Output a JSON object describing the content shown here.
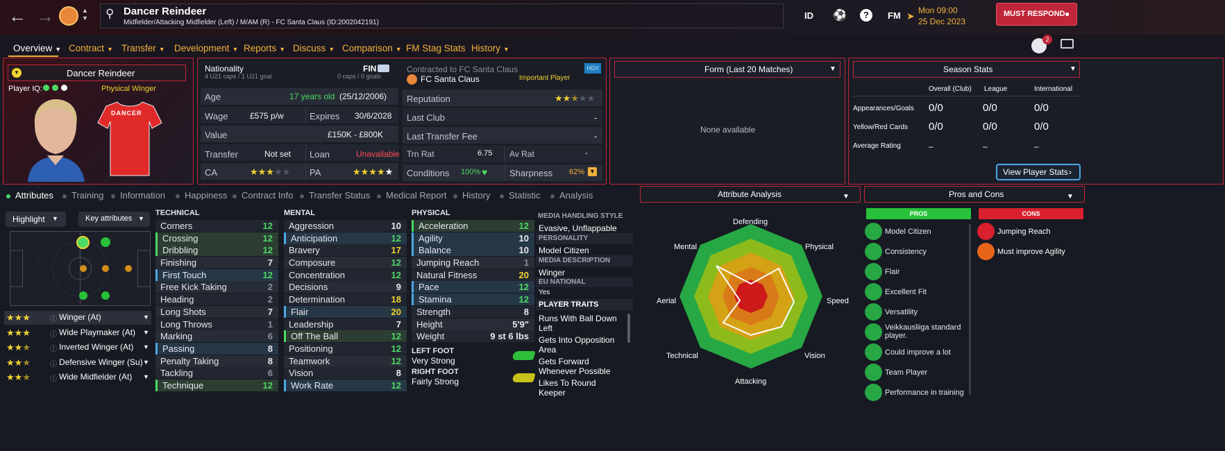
{
  "header": {
    "player_name": "Dancer Reindeer",
    "subtitle": "Midfielder/Attacking Midfielder (Left) / M/AM (R) - FC Santa Claus (ID:2002042191)",
    "id_label": "ID",
    "fm_label": "FM",
    "date_time": "Mon 09:00",
    "date": "25 Dec 2023",
    "must_respond": "MUST RESPOND"
  },
  "nav": {
    "overview": "Overview",
    "contract": "Contract",
    "transfer": "Transfer",
    "development": "Development",
    "reports": "Reports",
    "discuss": "Discuss",
    "comparison": "Comparison",
    "stag_stats": "FM Stag Stats",
    "history": "History",
    "notif_count": "2"
  },
  "profile": {
    "name": "Dancer Reindeer",
    "player_iq_label": "Player IQ:",
    "role": "Physical Winger",
    "shirt_name": "DANCER"
  },
  "info": {
    "nationality_label": "Nationality",
    "nation_code": "FIN",
    "u21_line": "4 U21 caps / 1 U21 goal",
    "caps_line": "0 caps / 0 goals",
    "age_label": "Age",
    "age_value": "17 years old",
    "dob": "(25/12/2006)",
    "wage_label": "Wage",
    "wage_value": "£575 p/w",
    "expires_label": "Expires",
    "expires_value": "30/6/2028",
    "value_label": "Value",
    "value_value": "£150K - £800K",
    "transfer_label": "Transfer",
    "transfer_value": "Not set",
    "loan_label": "Loan",
    "loan_value": "Unavailable",
    "ca_label": "CA",
    "pa_label": "PA",
    "ca_stars": 3,
    "pa_stars": 5
  },
  "club": {
    "contracted": "Contracted to FC Santa Claus",
    "club_name": "FC Santa Claus",
    "status": "Important Player",
    "badge": "HGV",
    "reputation_label": "Reputation",
    "reputation_stars": 2.5,
    "last_club_label": "Last Club",
    "last_club_value": "-",
    "last_fee_label": "Last Transfer Fee",
    "last_fee_value": "-",
    "trn_rat_label": "Trn Rat",
    "trn_rat_value": "6.75",
    "av_rat_label": "Av Rat",
    "av_rat_value": "-",
    "conditions_label": "Conditions",
    "conditions_value": "100%",
    "sharpness_label": "Sharpness",
    "sharpness_value": "62%"
  },
  "form": {
    "title": "Form (Last 20 Matches)",
    "empty": "None available"
  },
  "season": {
    "title": "Season Stats",
    "cols": [
      "Overall (Club)",
      "League",
      "International"
    ],
    "rows": [
      {
        "label": "Appearances/Goals",
        "values": [
          "0/0",
          "0/0",
          "0/0"
        ]
      },
      {
        "label": "Yellow/Red Cards",
        "values": [
          "0/0",
          "0/0",
          "0/0"
        ]
      },
      {
        "label": "Average Rating",
        "values": [
          "–",
          "–",
          "–"
        ]
      }
    ],
    "button": "View Player Stats"
  },
  "tabs": [
    "Attributes",
    "Training",
    "Information",
    "Happiness",
    "Contract Info",
    "Transfer Status",
    "Medical Report",
    "History",
    "Statistic",
    "Analysis"
  ],
  "controls": {
    "highlight": "Highlight",
    "key_attributes": "Key attributes"
  },
  "roles": [
    {
      "name": "Winger (At)",
      "stars": 3
    },
    {
      "name": "Wide Playmaker (At)",
      "stars": 3
    },
    {
      "name": "Inverted Winger (At)",
      "stars": 2.5
    },
    {
      "name": "Defensive Winger (Su)",
      "stars": 2.5
    },
    {
      "name": "Wide Midfielder (At)",
      "stars": 2.5
    }
  ],
  "technical": {
    "title": "TECHNICAL",
    "items": [
      {
        "name": "Corners",
        "value": "12"
      },
      {
        "name": "Crossing",
        "value": "12"
      },
      {
        "name": "Dribbling",
        "value": "12"
      },
      {
        "name": "Finishing",
        "value": "7"
      },
      {
        "name": "First Touch",
        "value": "12"
      },
      {
        "name": "Free Kick Taking",
        "value": "2"
      },
      {
        "name": "Heading",
        "value": "2"
      },
      {
        "name": "Long Shots",
        "value": "7"
      },
      {
        "name": "Long Throws",
        "value": "1"
      },
      {
        "name": "Marking",
        "value": "6"
      },
      {
        "name": "Passing",
        "value": "8"
      },
      {
        "name": "Penalty Taking",
        "value": "8"
      },
      {
        "name": "Tackling",
        "value": "6"
      },
      {
        "name": "Technique",
        "value": "12"
      }
    ]
  },
  "mental": {
    "title": "MENTAL",
    "items": [
      {
        "name": "Aggression",
        "value": "10"
      },
      {
        "name": "Anticipation",
        "value": "12"
      },
      {
        "name": "Bravery",
        "value": "17"
      },
      {
        "name": "Composure",
        "value": "12"
      },
      {
        "name": "Concentration",
        "value": "12"
      },
      {
        "name": "Decisions",
        "value": "9"
      },
      {
        "name": "Determination",
        "value": "18"
      },
      {
        "name": "Flair",
        "value": "20"
      },
      {
        "name": "Leadership",
        "value": "7"
      },
      {
        "name": "Off The Ball",
        "value": "12"
      },
      {
        "name": "Positioning",
        "value": "12"
      },
      {
        "name": "Teamwork",
        "value": "12"
      },
      {
        "name": "Vision",
        "value": "8"
      },
      {
        "name": "Work Rate",
        "value": "12"
      }
    ]
  },
  "physical": {
    "title": "PHYSICAL",
    "items": [
      {
        "name": "Acceleration",
        "value": "12"
      },
      {
        "name": "Agility",
        "value": "10"
      },
      {
        "name": "Balance",
        "value": "10"
      },
      {
        "name": "Jumping Reach",
        "value": "1"
      },
      {
        "name": "Natural Fitness",
        "value": "20"
      },
      {
        "name": "Pace",
        "value": "12"
      },
      {
        "name": "Stamina",
        "value": "12"
      },
      {
        "name": "Strength",
        "value": "8"
      }
    ],
    "height_label": "Height",
    "height_value": "5'9\"",
    "weight_label": "Weight",
    "weight_value": "9 st 6 lbs",
    "left_foot_label": "LEFT FOOT",
    "left_foot_value": "Very Strong",
    "right_foot_label": "RIGHT FOOT",
    "right_foot_value": "Fairly Strong"
  },
  "media": {
    "style_label": "MEDIA HANDLING STYLE",
    "style_value": "Evasive, Unflappable",
    "personality_label": "PERSONALITY",
    "personality_value": "Model Citizen",
    "desc_label": "MEDIA DESCRIPTION",
    "desc_value": "Winger",
    "eu_label": "EU NATIONAL",
    "eu_value": "Yes",
    "traits_label": "PLAYER TRAITS",
    "traits": [
      "Runs With Ball Down Left",
      "Gets Into Opposition Area",
      "Gets Forward Whenever Possible",
      "Likes To Round Keeper"
    ]
  },
  "analysis": {
    "title": "Attribute Analysis",
    "axes": [
      "Defending",
      "Physical",
      "Speed",
      "Vision",
      "Attacking",
      "Technical",
      "Aerial",
      "Mental"
    ]
  },
  "proscons": {
    "title": "Pros and Cons",
    "pros_label": "PROS",
    "cons_label": "CONS",
    "pros": [
      "Model Citizen",
      "Consistency",
      "Flair",
      "Excellent Fit",
      "Versatility",
      "Veikkausliiga standard player.",
      "Could improve a lot",
      "Team Player",
      "Performance in training"
    ],
    "cons": [
      "Jumping Reach",
      "Must improve Agility"
    ]
  },
  "colors": {
    "accent_red": "#c0263a",
    "orange": "#f2b13a",
    "green": "#4cd964",
    "yellow": "#f2d230"
  }
}
